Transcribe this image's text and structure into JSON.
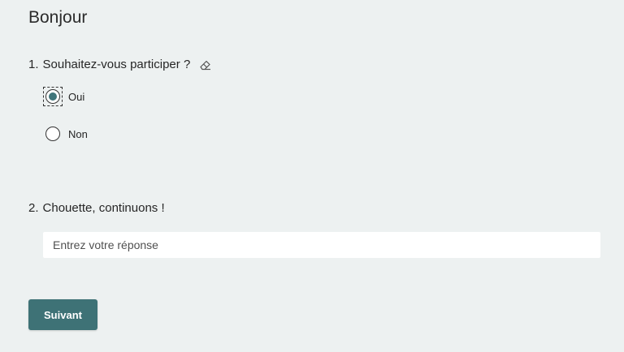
{
  "form": {
    "title": "Bonjour"
  },
  "questions": [
    {
      "number": "1.",
      "text": "Souhaitez-vous participer ?",
      "action_icon": "eraser-icon",
      "options": [
        {
          "label": "Oui",
          "selected": true
        },
        {
          "label": "Non",
          "selected": false
        }
      ]
    },
    {
      "number": "2.",
      "text": "Chouette, continuons !",
      "answer": {
        "value": "",
        "placeholder": "Entrez votre réponse"
      }
    }
  ],
  "actions": {
    "next_label": "Suivant"
  },
  "colors": {
    "background": "#edf1f1",
    "accent": "#3e7276",
    "radio_fill": "#40757a",
    "input_background": "#ffffff"
  }
}
